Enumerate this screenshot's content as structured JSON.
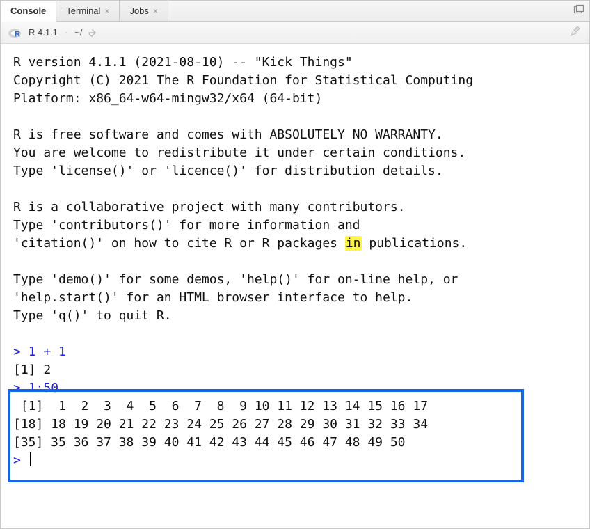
{
  "tabs": [
    {
      "label": "Console",
      "closable": false,
      "active": true
    },
    {
      "label": "Terminal",
      "closable": true,
      "active": false
    },
    {
      "label": "Jobs",
      "closable": true,
      "active": false
    }
  ],
  "toolbar": {
    "version": "R 4.1.1",
    "path": "~/"
  },
  "console": {
    "banner_lines": [
      "R version 4.1.1 (2021-08-10) -- \"Kick Things\"",
      "Copyright (C) 2021 The R Foundation for Statistical Computing",
      "Platform: x86_64-w64-mingw32/x64 (64-bit)",
      "",
      "R is free software and comes with ABSOLUTELY NO WARRANTY.",
      "You are welcome to redistribute it under certain conditions.",
      "Type 'license()' or 'licence()' for distribution details.",
      "",
      "R is a collaborative project with many contributors.",
      "Type 'contributors()' for more information and"
    ],
    "citation_prefix": "'citation()' on how to cite R or R packages ",
    "citation_highlight": "in",
    "citation_suffix": " publications.",
    "banner_tail": [
      "",
      "Type 'demo()' for some demos, 'help()' for on-line help, or",
      "'help.start()' for an HTML browser interface to help.",
      "Type 'q()' to quit R.",
      ""
    ],
    "prompt": ">",
    "cmd1": "1 + 1",
    "out1": "[1] 2",
    "cmd2": "1:50",
    "out2_lines": [
      " [1]  1  2  3  4  5  6  7  8  9 10 11 12 13 14 15 16 17",
      "[18] 18 19 20 21 22 23 24 25 26 27 28 29 30 31 32 33 34",
      "[35] 35 36 37 38 39 40 41 42 43 44 45 46 47 48 49 50"
    ]
  }
}
